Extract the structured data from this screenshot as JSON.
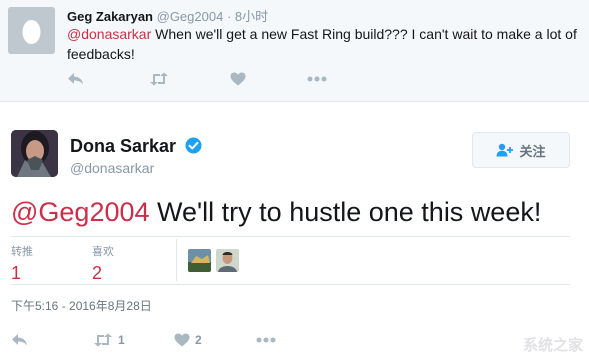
{
  "reply": {
    "name": "Geg Zakaryan",
    "handle": "@Geg2004",
    "separator": "·",
    "time": "8小时",
    "mention": "@donasarkar",
    "text": " When we'll get a new Fast Ring build??? I can't wait to make a lot of feedbacks!",
    "actions": [
      "reply-icon",
      "retweet-icon",
      "like-icon",
      "more-icon"
    ]
  },
  "tweet": {
    "author_name": "Dona Sarkar",
    "author_handle": "@donasarkar",
    "follow_label": "关注",
    "mention": "@Geg2004",
    "text": " We'll try to hustle one this week!",
    "stats": {
      "retweets_label": "转推",
      "retweets_value": "1",
      "likes_label": "喜欢",
      "likes_value": "2"
    },
    "timestamp": "下午5:16 - 2016年8月28日",
    "actions": {
      "retweet_count": "1",
      "like_count": "2"
    }
  },
  "watermark": "系统之家",
  "colors": {
    "accent": "#cc2f48",
    "muted": "#8899a6",
    "verified": "#1da1f2",
    "icon": "#aab8c2"
  }
}
